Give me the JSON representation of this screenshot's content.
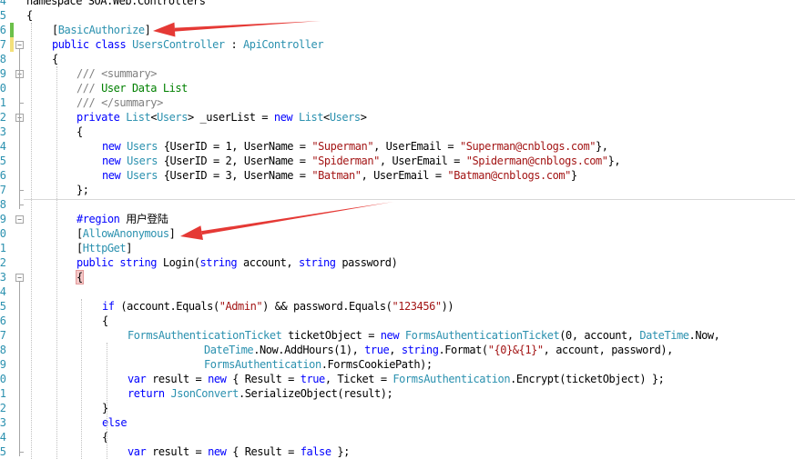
{
  "editor": {
    "lines": [
      {
        "ln": "4",
        "tokens": [
          {
            "t": "plain",
            "v": "namespace SOA.Web.Controllers"
          }
        ]
      },
      {
        "ln": "5",
        "tokens": [
          {
            "t": "plain",
            "v": "{"
          }
        ]
      },
      {
        "ln": "6",
        "tokens": [
          {
            "t": "plain",
            "v": "["
          },
          {
            "t": "ty",
            "v": "BasicAuthorize"
          },
          {
            "t": "plain",
            "v": "]"
          }
        ]
      },
      {
        "ln": "7",
        "tokens": [
          {
            "t": "kw",
            "v": "public class "
          },
          {
            "t": "ty",
            "v": "UsersController"
          },
          {
            "t": "plain",
            "v": " : "
          },
          {
            "t": "ty",
            "v": "ApiController"
          }
        ]
      },
      {
        "ln": "8",
        "tokens": [
          {
            "t": "plain",
            "v": "{"
          }
        ]
      },
      {
        "ln": "9",
        "tokens": [
          {
            "t": "xml",
            "v": "/// <summary>"
          }
        ]
      },
      {
        "ln": "0",
        "tokens": [
          {
            "t": "xml",
            "v": "/// "
          },
          {
            "t": "cm",
            "v": "User Data List"
          }
        ]
      },
      {
        "ln": "1",
        "tokens": [
          {
            "t": "xml",
            "v": "/// </summary>"
          }
        ]
      },
      {
        "ln": "2",
        "tokens": [
          {
            "t": "kw",
            "v": "private "
          },
          {
            "t": "ty",
            "v": "List"
          },
          {
            "t": "plain",
            "v": "<"
          },
          {
            "t": "ty",
            "v": "Users"
          },
          {
            "t": "plain",
            "v": "> _userList = "
          },
          {
            "t": "kw",
            "v": "new "
          },
          {
            "t": "ty",
            "v": "List"
          },
          {
            "t": "plain",
            "v": "<"
          },
          {
            "t": "ty",
            "v": "Users"
          },
          {
            "t": "plain",
            "v": ">"
          }
        ]
      },
      {
        "ln": "3",
        "tokens": [
          {
            "t": "plain",
            "v": "{"
          }
        ]
      },
      {
        "ln": "4",
        "tokens": [
          {
            "t": "kw",
            "v": "new "
          },
          {
            "t": "ty",
            "v": "Users"
          },
          {
            "t": "plain",
            "v": " {UserID = 1, UserName = "
          },
          {
            "t": "str",
            "v": "\"Superman\""
          },
          {
            "t": "plain",
            "v": ", UserEmail = "
          },
          {
            "t": "str",
            "v": "\"Superman@cnblogs.com\""
          },
          {
            "t": "plain",
            "v": "},"
          }
        ]
      },
      {
        "ln": "5",
        "tokens": [
          {
            "t": "kw",
            "v": "new "
          },
          {
            "t": "ty",
            "v": "Users"
          },
          {
            "t": "plain",
            "v": " {UserID = 2, UserName = "
          },
          {
            "t": "str",
            "v": "\"Spiderman\""
          },
          {
            "t": "plain",
            "v": ", UserEmail = "
          },
          {
            "t": "str",
            "v": "\"Spiderman@cnblogs.com\""
          },
          {
            "t": "plain",
            "v": "},"
          }
        ]
      },
      {
        "ln": "6",
        "tokens": [
          {
            "t": "kw",
            "v": "new "
          },
          {
            "t": "ty",
            "v": "Users"
          },
          {
            "t": "plain",
            "v": " {UserID = 3, UserName = "
          },
          {
            "t": "str",
            "v": "\"Batman\""
          },
          {
            "t": "plain",
            "v": ", UserEmail = "
          },
          {
            "t": "str",
            "v": "\"Batman@cnblogs.com\""
          },
          {
            "t": "plain",
            "v": "}"
          }
        ]
      },
      {
        "ln": "7",
        "tokens": [
          {
            "t": "plain",
            "v": "};"
          }
        ]
      },
      {
        "ln": "8",
        "tokens": []
      },
      {
        "ln": "9",
        "tokens": [
          {
            "t": "rg",
            "v": "#region "
          },
          {
            "t": "plain",
            "v": "用户登陆"
          }
        ]
      },
      {
        "ln": "0",
        "tokens": [
          {
            "t": "plain",
            "v": "["
          },
          {
            "t": "ty",
            "v": "AllowAnonymous"
          },
          {
            "t": "plain",
            "v": "]"
          }
        ]
      },
      {
        "ln": "1",
        "tokens": [
          {
            "t": "plain",
            "v": "["
          },
          {
            "t": "ty",
            "v": "HttpGet"
          },
          {
            "t": "plain",
            "v": "]"
          }
        ]
      },
      {
        "ln": "2",
        "tokens": [
          {
            "t": "kw",
            "v": "public string "
          },
          {
            "t": "plain",
            "v": "Login("
          },
          {
            "t": "kw",
            "v": "string "
          },
          {
            "t": "plain",
            "v": "account, "
          },
          {
            "t": "kw",
            "v": "string "
          },
          {
            "t": "plain",
            "v": "password)"
          }
        ]
      },
      {
        "ln": "3",
        "tokens": [
          {
            "t": "hl",
            "v": "{"
          }
        ]
      },
      {
        "ln": "4",
        "tokens": []
      },
      {
        "ln": "5",
        "tokens": [
          {
            "t": "kw",
            "v": "if "
          },
          {
            "t": "plain",
            "v": "(account.Equals("
          },
          {
            "t": "str",
            "v": "\"Admin\""
          },
          {
            "t": "plain",
            "v": ") && password.Equals("
          },
          {
            "t": "str",
            "v": "\"123456\""
          },
          {
            "t": "plain",
            "v": "))"
          }
        ]
      },
      {
        "ln": "6",
        "tokens": [
          {
            "t": "plain",
            "v": "{"
          }
        ]
      },
      {
        "ln": "7",
        "tokens": [
          {
            "t": "ty",
            "v": "FormsAuthenticationTicket"
          },
          {
            "t": "plain",
            "v": " ticketObject = "
          },
          {
            "t": "kw",
            "v": "new "
          },
          {
            "t": "ty",
            "v": "FormsAuthenticationTicket"
          },
          {
            "t": "plain",
            "v": "(0, account, "
          },
          {
            "t": "ty",
            "v": "DateTime"
          },
          {
            "t": "plain",
            "v": ".Now,"
          }
        ]
      },
      {
        "ln": "8",
        "tokens": [
          {
            "t": "ty",
            "v": "DateTime"
          },
          {
            "t": "plain",
            "v": ".Now.AddHours(1), "
          },
          {
            "t": "kw",
            "v": "true"
          },
          {
            "t": "plain",
            "v": ", "
          },
          {
            "t": "kw",
            "v": "string"
          },
          {
            "t": "plain",
            "v": ".Format("
          },
          {
            "t": "str",
            "v": "\"{0}&{1}\""
          },
          {
            "t": "plain",
            "v": ", account, password),"
          }
        ]
      },
      {
        "ln": "9",
        "tokens": [
          {
            "t": "ty",
            "v": "FormsAuthentication"
          },
          {
            "t": "plain",
            "v": ".FormsCookiePath);"
          }
        ]
      },
      {
        "ln": "0",
        "tokens": [
          {
            "t": "kw",
            "v": "var "
          },
          {
            "t": "plain",
            "v": "result = "
          },
          {
            "t": "kw",
            "v": "new "
          },
          {
            "t": "plain",
            "v": "{ Result = "
          },
          {
            "t": "kw",
            "v": "true"
          },
          {
            "t": "plain",
            "v": ", Ticket = "
          },
          {
            "t": "ty",
            "v": "FormsAuthentication"
          },
          {
            "t": "plain",
            "v": ".Encrypt(ticketObject) };"
          }
        ]
      },
      {
        "ln": "1",
        "tokens": [
          {
            "t": "kw",
            "v": "return "
          },
          {
            "t": "ty",
            "v": "JsonConvert"
          },
          {
            "t": "plain",
            "v": ".SerializeObject(result);"
          }
        ]
      },
      {
        "ln": "2",
        "tokens": [
          {
            "t": "plain",
            "v": "}"
          }
        ]
      },
      {
        "ln": "3",
        "tokens": [
          {
            "t": "kw",
            "v": "else"
          }
        ]
      },
      {
        "ln": "4",
        "tokens": [
          {
            "t": "plain",
            "v": "{"
          }
        ]
      },
      {
        "ln": "5",
        "tokens": [
          {
            "t": "kw",
            "v": "var "
          },
          {
            "t": "plain",
            "v": "result = "
          },
          {
            "t": "kw",
            "v": "new "
          },
          {
            "t": "plain",
            "v": "{ Result = "
          },
          {
            "t": "kw",
            "v": "false"
          },
          {
            "t": "plain",
            "v": " };"
          }
        ]
      }
    ]
  },
  "colors": {
    "keyword": "#0000ff",
    "type": "#2b91af",
    "string": "#a31515",
    "comment": "#008000",
    "annotation_arrow": "#e53935"
  }
}
